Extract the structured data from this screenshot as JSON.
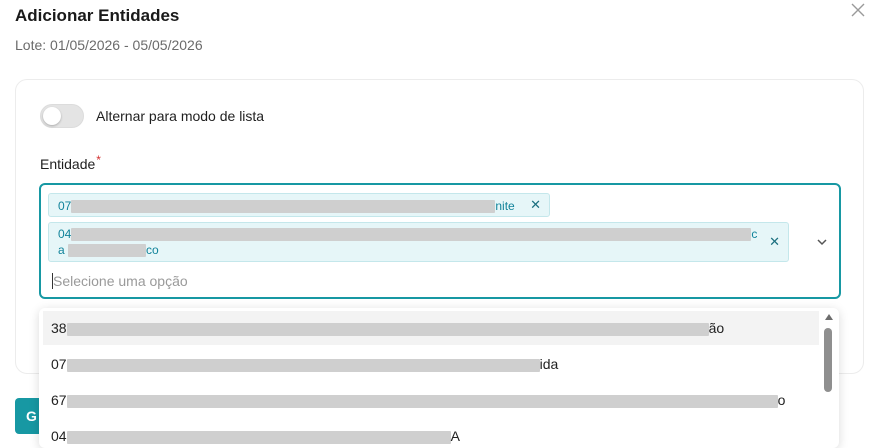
{
  "modal": {
    "title": "Adicionar Entidades",
    "subtitle": "Lote: 01/05/2026 - 05/05/2026"
  },
  "toggle": {
    "label": "Alternar para modo de lista",
    "on": false
  },
  "field": {
    "label": "Entidade",
    "required_mark": "*",
    "placeholder": "Selecione uma opção"
  },
  "selected_tags": [
    {
      "prefix": "07",
      "suffix": "nite"
    },
    {
      "line1_prefix": "04",
      "line1_suffix": "c",
      "line2_prefix": "a",
      "line2_suffix": "co"
    }
  ],
  "options": [
    {
      "prefix": "38",
      "suffix": "ão"
    },
    {
      "prefix": "07",
      "suffix": "ida"
    },
    {
      "prefix": "67",
      "suffix": "o"
    },
    {
      "prefix": "04",
      "suffix": "A"
    }
  ],
  "footer": {
    "save_label_visible": "G"
  },
  "colors": {
    "accent": "#1798a3",
    "tag_bg": "#e6f6f8",
    "tag_text": "#11839a",
    "required": "#d32f2f"
  }
}
